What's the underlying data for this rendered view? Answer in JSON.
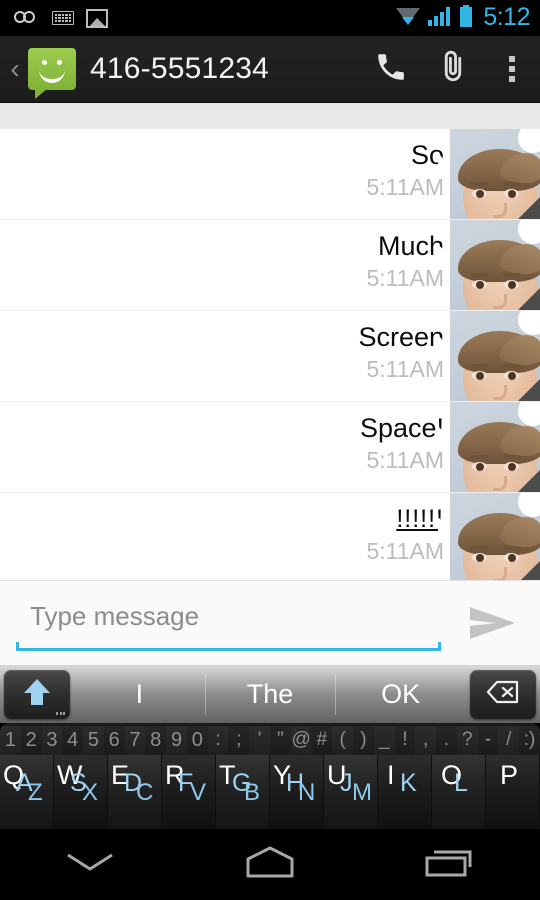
{
  "statusbar": {
    "time": "5:12",
    "icons": [
      "voicemail-icon",
      "keyboard-icon",
      "screenshot-icon",
      "wifi-icon",
      "signal-icon",
      "battery-icon"
    ],
    "accent_color": "#33b5e5"
  },
  "actionbar": {
    "back_label": "‹",
    "app_icon": "sms-smiley-icon",
    "app_icon_color": "#8bc040",
    "title": "416-5551234",
    "actions": [
      {
        "name": "call-button",
        "icon": "phone-icon"
      },
      {
        "name": "attach-button",
        "icon": "paperclip-icon"
      },
      {
        "name": "overflow-menu-button",
        "icon": "overflow-menu-icon"
      }
    ]
  },
  "conversation": {
    "messages": [
      {
        "text": "So",
        "time": "5:11AM",
        "avatar": "contact-photo"
      },
      {
        "text": "Much",
        "time": "5:11AM",
        "avatar": "contact-photo"
      },
      {
        "text": "Screen",
        "time": "5:11AM",
        "avatar": "contact-photo"
      },
      {
        "text": "Space!",
        "time": "5:11AM",
        "avatar": "contact-photo"
      },
      {
        "text": "!!!!!!",
        "time": "5:11AM",
        "avatar": "contact-photo"
      }
    ]
  },
  "compose": {
    "placeholder": "Type message",
    "value": "",
    "underline_color": "#33b5e5",
    "send_icon": "send-arrow-icon"
  },
  "keyboard": {
    "shift_key": {
      "name": "shift-key",
      "icon": "shift-arrow-icon",
      "color": "#9fd3ef"
    },
    "suggestions": [
      "I",
      "The",
      "OK"
    ],
    "backspace_key": {
      "name": "backspace-key",
      "icon": "backspace-icon"
    },
    "number_row": [
      "1",
      "2",
      "3",
      "4",
      "5",
      "6",
      "7",
      "8",
      "9",
      "0",
      ":",
      ";",
      "'",
      "\"",
      "@",
      "#",
      "(",
      ")",
      "_",
      "!",
      ",",
      ".",
      "?",
      "-",
      "/",
      ":)"
    ],
    "letter_keys": [
      {
        "primary": "Q",
        "secondary": "A",
        "tertiary": "Z"
      },
      {
        "primary": "W",
        "secondary": "S",
        "tertiary": "X"
      },
      {
        "primary": "E",
        "secondary": "D",
        "tertiary": "C"
      },
      {
        "primary": "R",
        "secondary": "F",
        "tertiary": "V"
      },
      {
        "primary": "T",
        "secondary": "G",
        "tertiary": "B"
      },
      {
        "primary": "Y",
        "secondary": "H",
        "tertiary": "N"
      },
      {
        "primary": "U",
        "secondary": "J",
        "tertiary": "M"
      },
      {
        "primary": "I",
        "secondary": "K",
        "tertiary": ""
      },
      {
        "primary": "O",
        "secondary": "L",
        "tertiary": ""
      },
      {
        "primary": "P",
        "secondary": "",
        "tertiary": ""
      }
    ]
  },
  "navbar": {
    "buttons": [
      {
        "name": "hide-keyboard-button",
        "icon": "chevron-down-icon"
      },
      {
        "name": "home-button",
        "icon": "home-icon"
      },
      {
        "name": "recents-button",
        "icon": "recents-icon"
      }
    ]
  }
}
